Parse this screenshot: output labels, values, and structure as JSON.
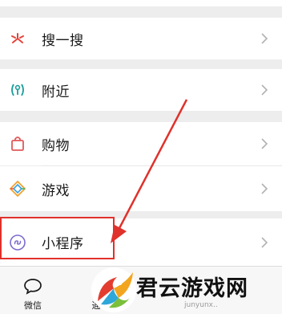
{
  "menu": {
    "items": [
      {
        "label": "搜一搜",
        "icon": "search-star-icon"
      },
      {
        "label": "附近",
        "icon": "nearby-person-icon"
      },
      {
        "label": "购物",
        "icon": "shopping-bag-icon"
      },
      {
        "label": "游戏",
        "icon": "game-diamond-icon"
      },
      {
        "label": "小程序",
        "icon": "mini-program-icon"
      }
    ]
  },
  "tabbar": {
    "tabs": [
      {
        "label": "微信",
        "icon": "chat-bubble-icon"
      },
      {
        "label": "通",
        "icon": "contacts-icon"
      }
    ]
  },
  "watermark": {
    "text": "君云游戏网",
    "subtext": "junyunx.."
  },
  "annotation": {
    "color": "#e0312b"
  }
}
